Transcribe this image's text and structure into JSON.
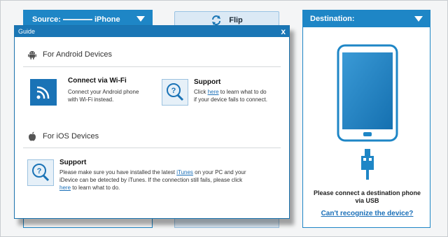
{
  "source": {
    "label_prefix": "Source:",
    "label_device": "iPhone"
  },
  "flip": {
    "label": "Flip"
  },
  "destination": {
    "title": "Destination:",
    "message_line1": "Please connect a destination phone",
    "message_line2": "via USB",
    "link": "Can't recognize the device?"
  },
  "guide": {
    "title": "Guide",
    "close": "x",
    "android": {
      "heading": "For Android Devices",
      "wifi": {
        "title": "Connect via Wi-Fi",
        "desc_line1": "Connect your Android phone",
        "desc_line2": "with Wi-Fi instead."
      },
      "support": {
        "title": "Support",
        "desc_pre": "Click ",
        "desc_link": "here",
        "desc_post": " to learn what to do",
        "desc_line2": "if your device fails to connect."
      }
    },
    "ios": {
      "heading": "For iOS Devices",
      "support": {
        "title": "Support",
        "line1_pre": "Please make sure you have installed the latest ",
        "line1_link": "iTunes",
        "line1_post": " on your PC and your",
        "line2": "iDevice can be detected by iTunes. If the connection still fails, please click",
        "line3_link": "here",
        "line3_post": " to learn what to do."
      }
    }
  },
  "colors": {
    "accent": "#1e86c6",
    "link": "#1a6fb8",
    "icon_tile": "#1a73b6"
  }
}
